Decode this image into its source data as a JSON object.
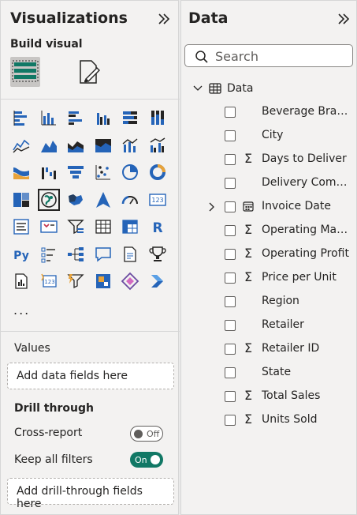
{
  "visualizations": {
    "title": "Visualizations",
    "build_visual_label": "Build visual",
    "more_label": "...",
    "values_label": "Values",
    "values_well_placeholder": "Add data fields here",
    "drill_through_label": "Drill through",
    "cross_report": {
      "label": "Cross-report",
      "state": "Off"
    },
    "keep_all_filters": {
      "label": "Keep all filters",
      "state": "On"
    },
    "drill_well_placeholder": "Add drill-through fields here",
    "icons": [
      "stacked-bar-chart-icon",
      "stacked-column-chart-icon",
      "clustered-bar-chart-icon",
      "clustered-column-chart-icon",
      "100-stacked-bar-chart-icon",
      "100-stacked-column-chart-icon",
      "line-chart-icon",
      "area-chart-icon",
      "stacked-area-chart-icon",
      "100-stacked-area-chart-icon",
      "line-and-stacked-column-chart-icon",
      "line-and-clustered-column-chart-icon",
      "ribbon-chart-icon",
      "waterfall-chart-icon",
      "funnel-chart-icon",
      "scatter-chart-icon",
      "pie-chart-icon",
      "donut-chart-icon",
      "treemap-icon",
      "map-icon",
      "filled-map-icon",
      "azure-map-icon",
      "gauge-icon",
      "card-icon",
      "multi-row-card-icon",
      "kpi-icon",
      "slicer-icon",
      "table-icon",
      "matrix-icon",
      "r-script-visual-icon",
      "python-visual-icon",
      "key-influencers-icon",
      "decomposition-tree-icon",
      "qa-icon",
      "smart-narrative-icon",
      "metrics-icon",
      "paginated-report-icon",
      "card-new-icon",
      "power-automate-icon",
      "power-apps-icon",
      "sparkle-visual-icon",
      "power-apps-chevron-icon"
    ],
    "selected_icon": "map-icon"
  },
  "data": {
    "title": "Data",
    "search_placeholder": "Search",
    "table_name": "Data",
    "fields": [
      {
        "label": "Beverage Brand",
        "icon": ""
      },
      {
        "label": "City",
        "icon": ""
      },
      {
        "label": "Days to Deliver",
        "icon": "Σ"
      },
      {
        "label": "Delivery Compa...",
        "icon": ""
      },
      {
        "label": "Invoice Date",
        "icon": "calendar",
        "expandable": true
      },
      {
        "label": "Operating Mar...",
        "icon": "Σ"
      },
      {
        "label": "Operating Profit",
        "icon": "Σ"
      },
      {
        "label": "Price per Unit",
        "icon": "Σ"
      },
      {
        "label": "Region",
        "icon": ""
      },
      {
        "label": "Retailer",
        "icon": ""
      },
      {
        "label": "Retailer ID",
        "icon": "Σ"
      },
      {
        "label": "State",
        "icon": ""
      },
      {
        "label": "Total Sales",
        "icon": "Σ"
      },
      {
        "label": "Units Sold",
        "icon": "Σ"
      }
    ]
  },
  "colors": {
    "accent_teal": "#117865",
    "panel_bg": "#f3f2f1",
    "icon_blue": "#2564b8",
    "icon_orange": "#e8a33a",
    "icon_purple": "#6b4ba1"
  }
}
